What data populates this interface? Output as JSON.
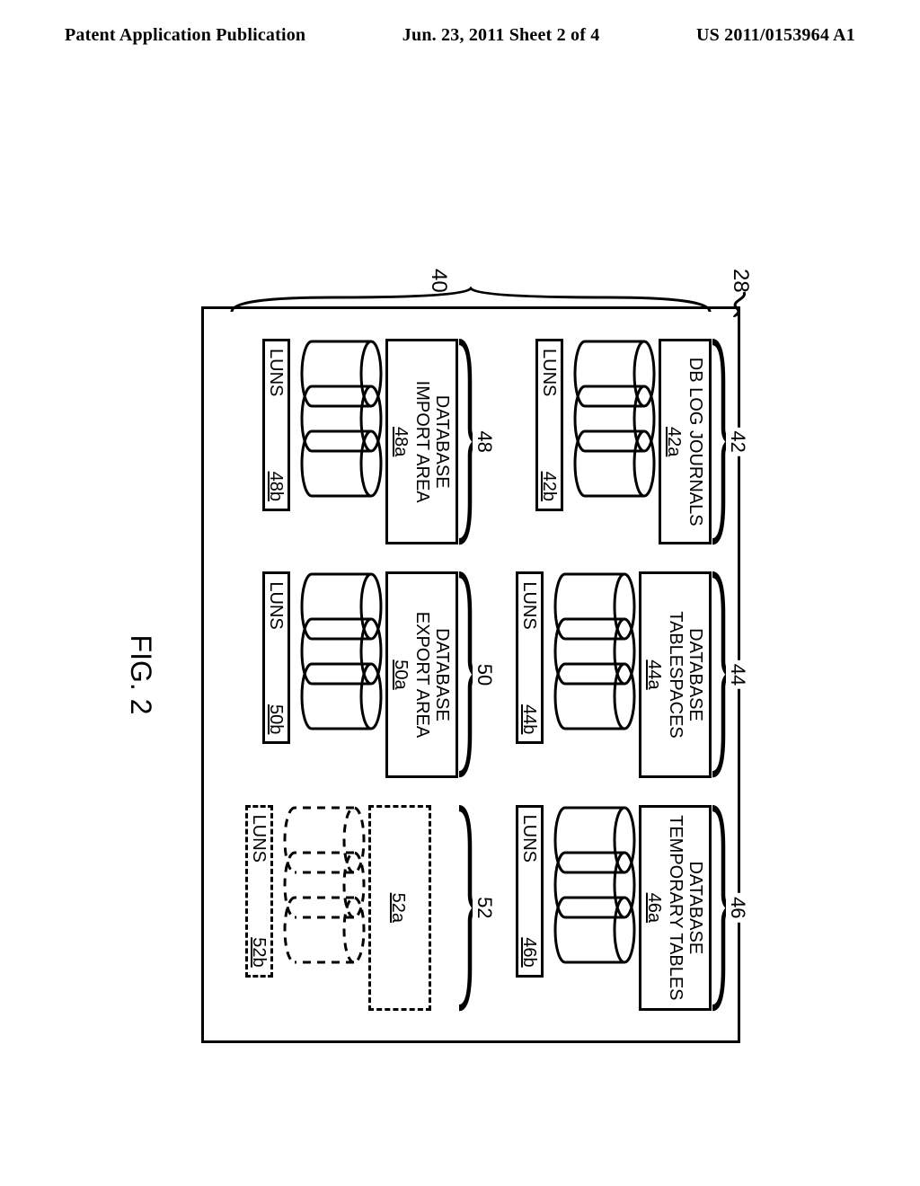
{
  "header": {
    "left": "Patent Application Publication",
    "middle": "Jun. 23, 2011  Sheet 2 of 4",
    "right": "US 2011/0153964 A1"
  },
  "figure_caption": "FIG. 2",
  "outer_ref": "28",
  "side_ref": "40",
  "luns_label": "LUNS",
  "groups": [
    {
      "id": "42",
      "title": "DB LOG JOURNALS",
      "title_ref": "42a",
      "luns_ref": "42b",
      "dashed": false,
      "has_title": true
    },
    {
      "id": "44",
      "title": "DATABASE\nTABLESPACES",
      "title_ref": "44a",
      "luns_ref": "44b",
      "dashed": false,
      "has_title": true
    },
    {
      "id": "46",
      "title": "DATABASE\nTEMPORARY TABLES",
      "title_ref": "46a",
      "luns_ref": "46b",
      "dashed": false,
      "has_title": true
    },
    {
      "id": "48",
      "title": "DATABASE\nIMPORT AREA",
      "title_ref": "48a",
      "luns_ref": "48b",
      "dashed": false,
      "has_title": true
    },
    {
      "id": "50",
      "title": "DATABASE\nEXPORT AREA",
      "title_ref": "50a",
      "luns_ref": "50b",
      "dashed": false,
      "has_title": true
    },
    {
      "id": "52",
      "title": "",
      "title_ref": "52a",
      "luns_ref": "52b",
      "dashed": true,
      "has_title": false
    }
  ]
}
